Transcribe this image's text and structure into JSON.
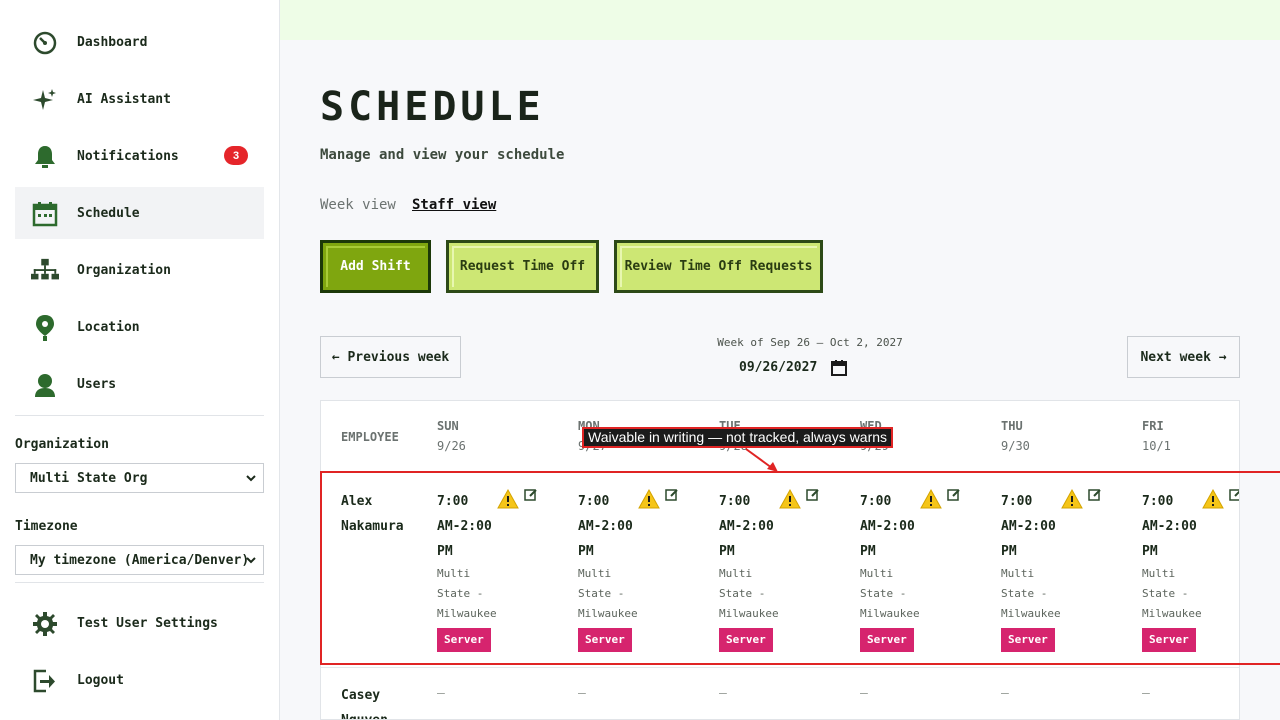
{
  "sidebar": {
    "items": [
      {
        "label": "Dashboard",
        "icon": "dashboard-icon"
      },
      {
        "label": "AI Assistant",
        "icon": "sparkle-icon"
      },
      {
        "label": "Notifications",
        "icon": "bell-icon",
        "badge": "3"
      },
      {
        "label": "Schedule",
        "icon": "calendar-icon",
        "active": true
      },
      {
        "label": "Organization",
        "icon": "org-chart-icon"
      },
      {
        "label": "Location",
        "icon": "location-pin-icon"
      },
      {
        "label": "Users",
        "icon": "user-icon"
      }
    ],
    "organization_label": "Organization",
    "organization_value": "Multi State Org",
    "timezone_label": "Timezone",
    "timezone_value": "My timezone (America/Denver)",
    "settings_label": "Test User Settings",
    "logout_label": "Logout"
  },
  "page": {
    "title": "SCHEDULE",
    "subtitle": "Manage and view your schedule",
    "view_week": "Week view",
    "view_staff": "Staff view"
  },
  "actions": {
    "add_shift": "Add Shift",
    "request_time_off": "Request Time Off",
    "review_requests": "Review Time Off Requests"
  },
  "week_nav": {
    "previous": "← Previous week",
    "next": "Next week →",
    "week_of": "Week of Sep 26 – Oct 2, 2027",
    "date_value": "09/26/2027"
  },
  "table": {
    "employee_header": "EMPLOYEE",
    "days": [
      {
        "day": "SUN",
        "date": "9/26"
      },
      {
        "day": "MON",
        "date": "9/27"
      },
      {
        "day": "TUE",
        "date": "9/28"
      },
      {
        "day": "WED",
        "date": "9/29"
      },
      {
        "day": "THU",
        "date": "9/30"
      },
      {
        "day": "FRI",
        "date": "10/1"
      }
    ],
    "rows": [
      {
        "employee": "Alex Nakamura",
        "shift_time": [
          "7:00",
          "AM-2:00",
          "PM"
        ],
        "shift_location": [
          "Multi",
          "State -",
          "Milwaukee"
        ],
        "role": "Server"
      },
      {
        "employee": "Casey Nguyen",
        "empty": "–"
      }
    ]
  },
  "tooltip": "Waivable in writing — not tracked, always warns",
  "colors": {
    "accent_green": "#7fa60f",
    "light_green": "#cde774",
    "role_pink": "#d6246e",
    "badge_red": "#e5252a",
    "warning_yellow": "#f5c518"
  }
}
